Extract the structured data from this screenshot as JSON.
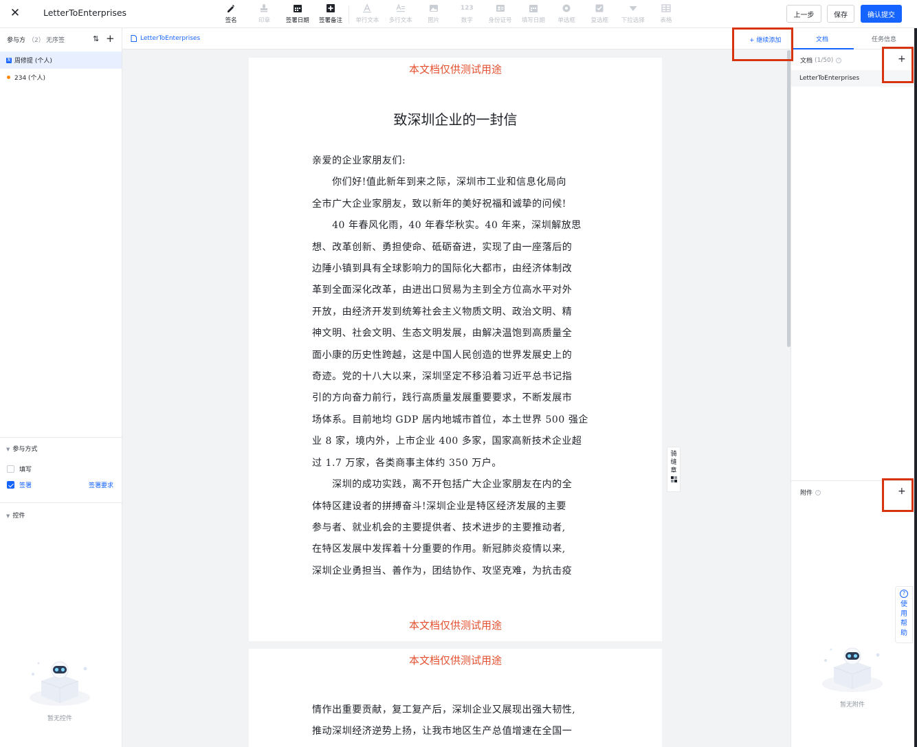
{
  "header": {
    "title": "LetterToEnterprises",
    "tools": [
      {
        "label": "签名",
        "icon": "pen-icon",
        "enabled": true
      },
      {
        "label": "印章",
        "icon": "stamp-icon",
        "enabled": false
      },
      {
        "label": "签署日期",
        "icon": "calendar-icon",
        "enabled": true
      },
      {
        "label": "签署备注",
        "icon": "note-plus-icon",
        "enabled": true
      },
      {
        "label": "单行文本",
        "icon": "text-a-icon",
        "enabled": false
      },
      {
        "label": "多行文本",
        "icon": "multiline-text-icon",
        "enabled": false
      },
      {
        "label": "图片",
        "icon": "image-icon",
        "enabled": false
      },
      {
        "label": "数字",
        "icon": "number-icon",
        "enabled": false
      },
      {
        "label": "身份证号",
        "icon": "id-card-icon",
        "enabled": false
      },
      {
        "label": "填写日期",
        "icon": "fill-date-icon",
        "enabled": false
      },
      {
        "label": "单选框",
        "icon": "radio-icon",
        "enabled": false
      },
      {
        "label": "复选框",
        "icon": "checkbox-icon",
        "enabled": false
      },
      {
        "label": "下拉选择",
        "icon": "dropdown-icon",
        "enabled": false
      },
      {
        "label": "表格",
        "icon": "table-icon",
        "enabled": false
      }
    ],
    "buttons": {
      "prev": "上一步",
      "save": "保存",
      "submit": "确认提交"
    }
  },
  "left": {
    "participants_title": "参与方",
    "participants_count": "（2）",
    "unordered": "无序签",
    "parties": [
      {
        "badge": "发",
        "name": "周修提 (个人)"
      },
      {
        "name": "234 (个人)"
      }
    ],
    "method_title": "参与方式",
    "method_fill": "填写",
    "method_sign": "签署",
    "sign_requirements": "签署要求",
    "controls_title": "控件",
    "no_controls": "暂无控件"
  },
  "canvas": {
    "breadcrumb": "LetterToEnterprises",
    "continue_add": "+ 继续添加",
    "watermark": "本文档仅供测试用途",
    "letter_title": "致深圳企业的一封信",
    "page1_lines": [
      "亲爱的企业家朋友们:",
      "　　你们好!值此新年到来之际，深圳市工业和信息化局向",
      "全市广大企业家朋友，致以新年的美好祝福和诚挚的问候!",
      "　　40 年春风化雨，40 年春华秋实。40 年来，深圳解放思",
      "想、改革创新、勇担使命、砥砺奋进，实现了由一座落后的",
      "边陲小镇到具有全球影响力的国际化大都市，由经济体制改",
      "革到全面深化改革，由进出口贸易为主到全方位高水平对外",
      "开放，由经济开发到统筹社会主义物质文明、政治文明、精",
      "神文明、社会文明、生态文明发展，由解决温饱到高质量全",
      "面小康的历史性跨越，这是中国人民创造的世界发展史上的",
      "奇迹。党的十八大以来，深圳坚定不移沿着习近平总书记指",
      "引的方向奋力前行，践行高质量发展重要要求，不断发展市",
      "场体系。目前地均 GDP 居内地城市首位，本土世界 500 强企",
      "业 8 家，境内外，上市企业 400 多家，国家高新技术企业超",
      "过 1.7 万家，各类商事主体约 350 万户。",
      "　　深圳的成功实践，离不开包括广大企业家朋友在内的全",
      "体特区建设者的拼搏奋斗!深圳企业是特区经济发展的主要",
      "参与者、就业机会的主要提供者、技术进步的主要推动者,",
      "在特区发展中发挥着十分重要的作用。新冠肺炎疫情以来,",
      "深圳企业勇担当、善作为，团结协作、攻坚克难，为抗击疫"
    ],
    "page2_lines": [
      "情作出重要贡献，复工复产后，深圳企业又展现出强大韧性,",
      "推动深圳经济逆势上扬，让我市地区生产总值增速在全国一"
    ],
    "seam_label": [
      "骑",
      "缝",
      "章"
    ]
  },
  "right": {
    "tab_doc": "文档",
    "tab_task": "任务信息",
    "docs_title": "文档",
    "docs_count": "(1/50)",
    "doc_item": "LetterToEnterprises",
    "attach_title": "附件",
    "plus": "+",
    "no_attachments": "暂无附件",
    "help": [
      "使",
      "用",
      "帮",
      "助"
    ]
  },
  "colors": {
    "accent": "#1664ff",
    "watermark": "#e4502f",
    "highlight": "#d7330f"
  }
}
